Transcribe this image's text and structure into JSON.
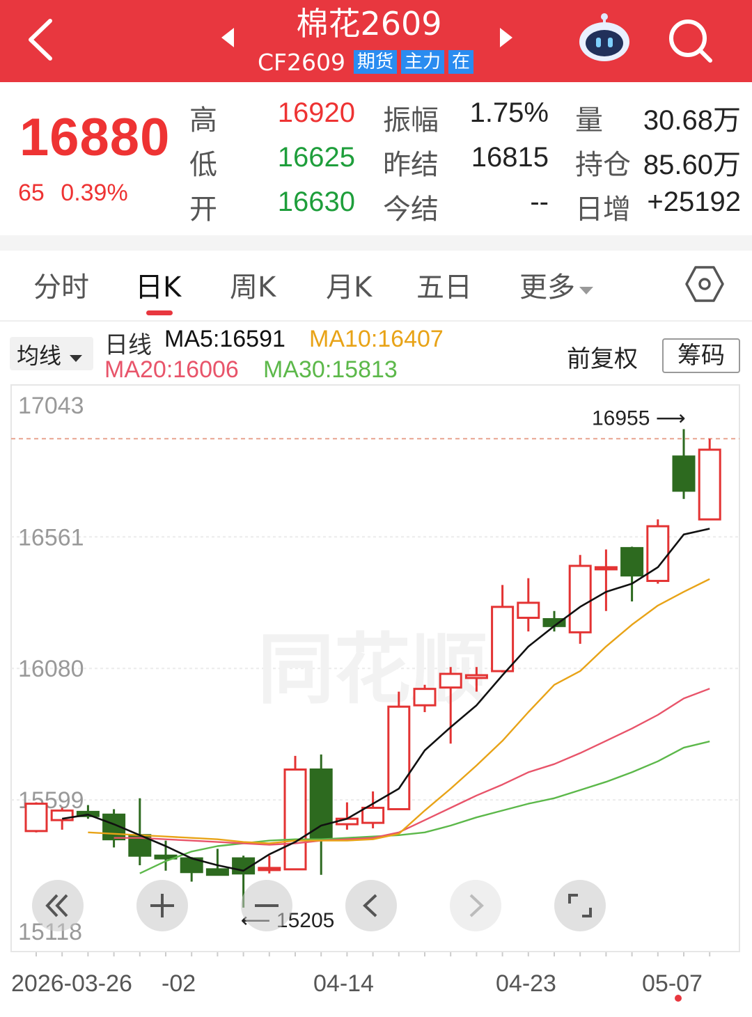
{
  "header": {
    "title": "棉花2609",
    "code": "CF2609",
    "tags": [
      "期货",
      "主力",
      "在"
    ],
    "icons": {
      "back": "back-arrow-icon",
      "prev": "prev-contract-icon",
      "next": "next-contract-icon",
      "assistant": "robot-assistant-icon",
      "search": "search-icon"
    }
  },
  "quote": {
    "last_price": "16880",
    "change": "65",
    "change_pct": "0.39%",
    "high_label": "高",
    "high": "16920",
    "low_label": "低",
    "low": "16625",
    "open_label": "开",
    "open": "16630",
    "amplitude_label": "振幅",
    "amplitude": "1.75%",
    "prev_settle_label": "昨结",
    "prev_settle": "16815",
    "settle_label": "今结",
    "settle": "--",
    "volume_label": "量",
    "volume": "30.68万",
    "open_interest_label": "持仓",
    "open_interest": "85.60万",
    "daily_change_label": "日增",
    "daily_change": "+25192"
  },
  "tabs": {
    "items": [
      "分时",
      "日K",
      "周K",
      "月K",
      "五日",
      "更多"
    ],
    "active": "日K",
    "settings_icon": "settings-hexagon-icon"
  },
  "indicator_bar": {
    "select_label": "均线",
    "prefix": "日线",
    "ma5": "MA5:16591",
    "ma10": "MA10:16407",
    "ma20": "MA20:16006",
    "ma30": "MA30:15813",
    "adjust_label": "前复权",
    "chips_button": "筹码",
    "colors": {
      "ma5": "#111111",
      "ma10": "#e8a317",
      "ma20": "#e8546a",
      "ma30": "#5cb84a"
    }
  },
  "chart_data": {
    "type": "candlestick",
    "y_ticks": [
      "17043",
      "16561",
      "16080",
      "15599",
      "15118"
    ],
    "ylim": [
      15118,
      17043
    ],
    "x_labels": [
      "2026-03-26",
      "-02",
      "04-14",
      "04-23",
      "05-07"
    ],
    "reference_line": 16920,
    "max_label": "16955",
    "min_label": "15205",
    "colors": {
      "up": "#e33333",
      "down": "#2d6a1f"
    },
    "candles": [
      {
        "o": 15485,
        "c": 15585,
        "h": 15590,
        "l": 15480
      },
      {
        "o": 15525,
        "c": 15560,
        "h": 15570,
        "l": 15490
      },
      {
        "o": 15555,
        "c": 15540,
        "h": 15580,
        "l": 15530
      },
      {
        "o": 15545,
        "c": 15455,
        "h": 15565,
        "l": 15425
      },
      {
        "o": 15470,
        "c": 15395,
        "h": 15605,
        "l": 15360
      },
      {
        "o": 15395,
        "c": 15385,
        "h": 15450,
        "l": 15340
      },
      {
        "o": 15385,
        "c": 15335,
        "h": 15390,
        "l": 15300
      },
      {
        "o": 15345,
        "c": 15325,
        "h": 15420,
        "l": 15325
      },
      {
        "o": 15385,
        "c": 15330,
        "h": 15395,
        "l": 15205
      },
      {
        "o": 15345,
        "c": 15350,
        "h": 15395,
        "l": 15330
      },
      {
        "o": 15345,
        "c": 15710,
        "h": 15760,
        "l": 15345
      },
      {
        "o": 15710,
        "c": 15460,
        "h": 15765,
        "l": 15325
      },
      {
        "o": 15510,
        "c": 15530,
        "h": 15590,
        "l": 15490
      },
      {
        "o": 15515,
        "c": 15570,
        "h": 15630,
        "l": 15495
      },
      {
        "o": 15565,
        "c": 15940,
        "h": 15995,
        "l": 15565
      },
      {
        "o": 15945,
        "c": 16005,
        "h": 16020,
        "l": 15920
      },
      {
        "o": 16010,
        "c": 16060,
        "h": 16085,
        "l": 15805
      },
      {
        "o": 16045,
        "c": 16055,
        "h": 16085,
        "l": 15995
      },
      {
        "o": 16070,
        "c": 16305,
        "h": 16385,
        "l": 16065
      },
      {
        "o": 16265,
        "c": 16320,
        "h": 16410,
        "l": 16215
      },
      {
        "o": 16260,
        "c": 16235,
        "h": 16290,
        "l": 16215
      },
      {
        "o": 16212,
        "c": 16455,
        "h": 16495,
        "l": 16170
      },
      {
        "o": 16445,
        "c": 16450,
        "h": 16515,
        "l": 16290
      },
      {
        "o": 16520,
        "c": 16420,
        "h": 16525,
        "l": 16325
      },
      {
        "o": 16400,
        "c": 16600,
        "h": 16625,
        "l": 16390
      },
      {
        "o": 16855,
        "c": 16730,
        "h": 16955,
        "l": 16700
      },
      {
        "o": 16625,
        "c": 16880,
        "h": 16920,
        "l": 16625
      }
    ],
    "ma5": [
      15530,
      15545,
      15510,
      15470,
      15430,
      15385,
      15360,
      15340,
      15400,
      15445,
      15505,
      15530,
      15585,
      15640,
      15780,
      15865,
      15945,
      16055,
      16160,
      16235,
      16305,
      16360,
      16390,
      16450,
      16570,
      16591
    ],
    "ma10": [
      15480,
      15475,
      15470,
      15465,
      15460,
      15455,
      15445,
      15440,
      15450,
      15450,
      15450,
      15455,
      15475,
      15560,
      15640,
      15725,
      15815,
      15920,
      16020,
      16070,
      16160,
      16240,
      16310,
      16360,
      16407
    ],
    "ma20": [
      15460,
      15460,
      15455,
      15450,
      15445,
      15440,
      15435,
      15440,
      15450,
      15455,
      15460,
      15480,
      15525,
      15570,
      15615,
      15655,
      15700,
      15730,
      15770,
      15815,
      15860,
      15910,
      15970,
      16006
    ],
    "ma30": [
      15330,
      15375,
      15410,
      15430,
      15440,
      15450,
      15455,
      15455,
      15460,
      15465,
      15470,
      15480,
      15505,
      15535,
      15560,
      15585,
      15605,
      15635,
      15665,
      15700,
      15740,
      15790,
      15813
    ]
  },
  "chart_controls": {
    "icons": [
      "rewind-icon",
      "zoom-in-icon",
      "zoom-out-icon",
      "scroll-left-icon",
      "scroll-right-icon",
      "fullscreen-icon"
    ]
  }
}
